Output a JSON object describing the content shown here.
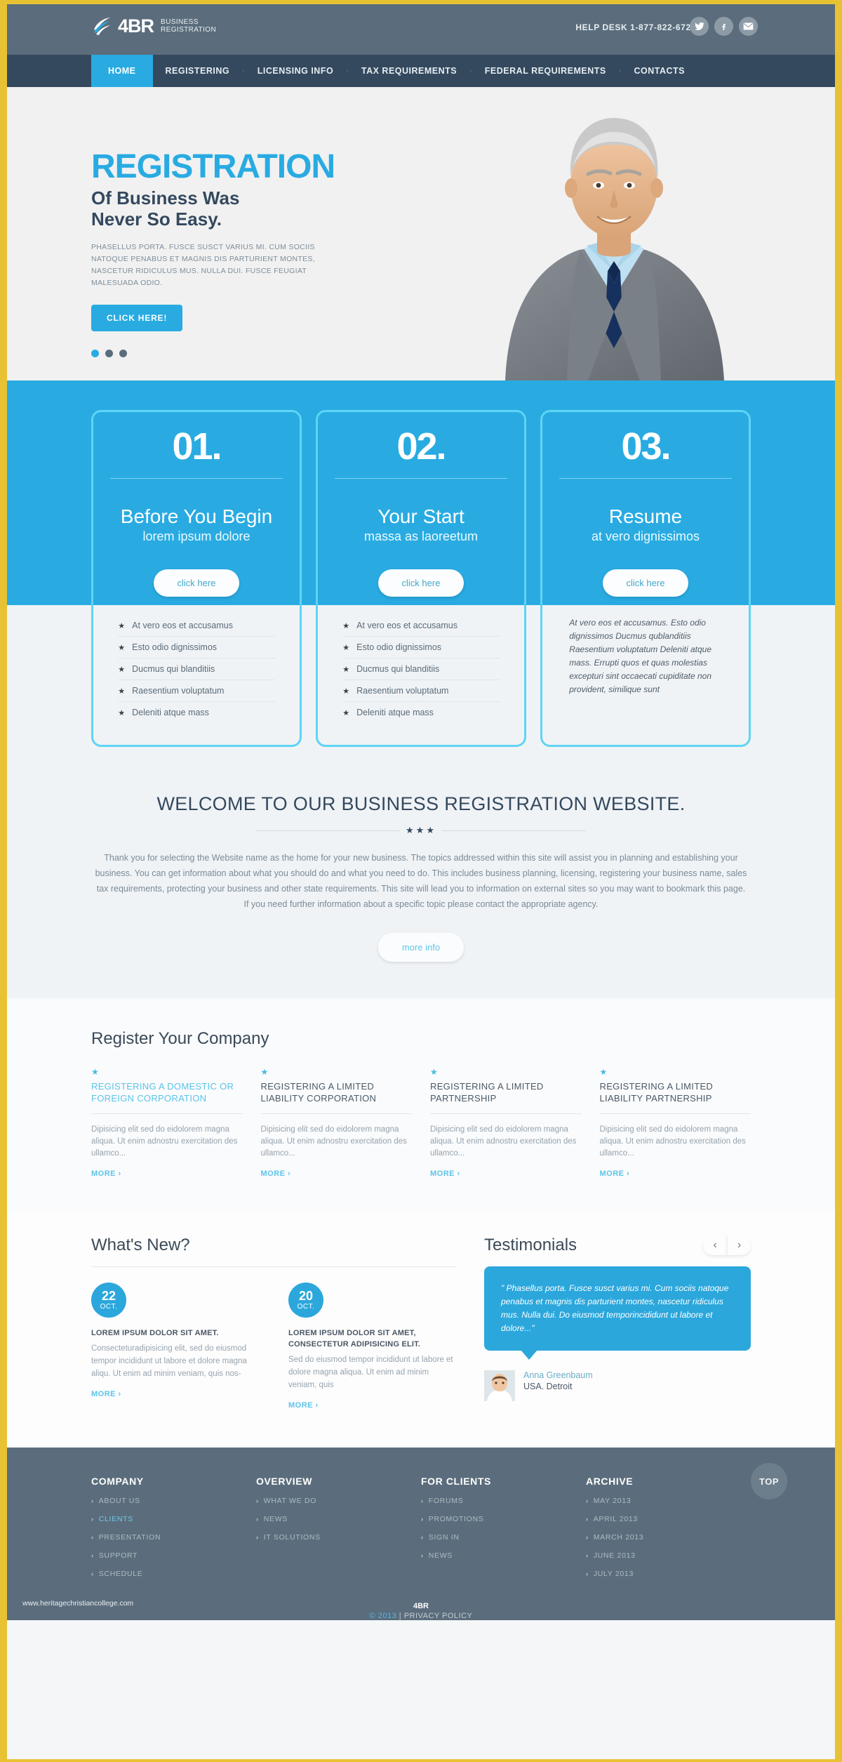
{
  "header": {
    "logo_main": "4BR",
    "logo_sub_line1": "BUSINESS",
    "logo_sub_line2": "REGISTRATION",
    "help_desk": "HELP DESK 1-877-822-6727",
    "social": [
      {
        "name": "twitter-icon",
        "glyph": "🐦"
      },
      {
        "name": "facebook-icon",
        "glyph": "f"
      },
      {
        "name": "email-icon",
        "glyph": "✉"
      }
    ]
  },
  "nav": {
    "items": [
      {
        "label": "HOME",
        "active": true
      },
      {
        "label": "REGISTERING",
        "active": false
      },
      {
        "label": "LICENSING INFO",
        "active": false
      },
      {
        "label": "TAX REQUIREMENTS",
        "active": false
      },
      {
        "label": "FEDERAL REQUIREMENTS",
        "active": false
      },
      {
        "label": "CONTACTS",
        "active": false
      }
    ],
    "separator": "·"
  },
  "hero": {
    "title": "REGISTRATION",
    "subtitle_line1": "Of Business Was",
    "subtitle_line2": "Never So Easy.",
    "paragraph": "PHASELLUS PORTA. FUSCE SUSCT VARIUS MI. CUM SOCIIS NATOQUE PENABUS ET MAGNIS DIS PARTURIENT MONTES, NASCETUR RIDICULUS MUS. NULLA DUI. FUSCE FEUGIAT MALESUADA ODIO.",
    "button": "CLICK HERE!",
    "slide_count": 3,
    "active_slide": 1
  },
  "features": {
    "boxes": [
      {
        "number": "01.",
        "title": "Before You Begin",
        "subtitle": "lorem ipsum dolore",
        "button": "click here",
        "list": [
          "At vero eos et accusamus",
          "Esto odio dignissimos",
          "Ducmus qui blanditiis",
          "Raesentium voluptatum",
          "Deleniti atque mass"
        ],
        "paragraph": ""
      },
      {
        "number": "02.",
        "title": "Your Start",
        "subtitle": "massa as laoreetum",
        "button": "click here",
        "list": [
          "At vero eos et accusamus",
          "Esto odio dignissimos",
          "Ducmus qui blanditiis",
          "Raesentium voluptatum",
          "Deleniti atque mass"
        ],
        "paragraph": ""
      },
      {
        "number": "03.",
        "title": "Resume",
        "subtitle": "at vero dignissimos",
        "button": "click here",
        "list": [],
        "paragraph": "At vero eos et accusamus.  Esto odio dignissimos Ducmus qublanditiis Raesentium voluptatum Deleniti atque mass. Errupti quos et quas molestias excepturi sint occaecati cupiditate non provident, similique sunt"
      }
    ],
    "star_glyph": "★"
  },
  "welcome": {
    "heading": "WELCOME TO OUR BUSINESS REGISTRATION WEBSITE.",
    "stars": "★★★",
    "paragraph": "Thank you for selecting the Website name as the home for your new business. The topics addressed within this site will assist you in planning and establishing your business. You can get information about what you should do and what you need to do. This includes business planning, licensing, registering your business name, sales tax requirements, protecting your business and other state requirements. This site will lead you to information on external sites so you may want to bookmark this page. If you need further information about a specific topic please contact the appropriate agency.",
    "button": "more info"
  },
  "register": {
    "heading": "Register Your Company",
    "more_label": "MORE",
    "more_arrow": "›",
    "star_glyph": "★",
    "cards": [
      {
        "title": "REGISTERING A DOMESTIC OR FOREIGN CORPORATION",
        "highlighted": true,
        "text": "Dipisicing elit sed do eidolorem magna aliqua. Ut enim adnostru exercitation des ullamco..."
      },
      {
        "title": "REGISTERING A LIMITED LIABILITY CORPORATION",
        "highlighted": false,
        "text": "Dipisicing elit sed do eidolorem magna aliqua. Ut enim adnostru exercitation des ullamco..."
      },
      {
        "title": "REGISTERING A LIMITED PARTNERSHIP",
        "highlighted": false,
        "text": "Dipisicing elit sed do eidolorem magna aliqua. Ut enim adnostru exercitation des ullamco..."
      },
      {
        "title": "REGISTERING A LIMITED LIABILITY PARTNERSHIP",
        "highlighted": false,
        "text": "Dipisicing elit sed do eidolorem magna aliqua. Ut enim adnostru exercitation des ullamco..."
      }
    ]
  },
  "news": {
    "heading": "What's New?",
    "more_label": "MORE",
    "more_arrow": "›",
    "items": [
      {
        "day": "22",
        "month": "OCT.",
        "title": "LOREM IPSUM DOLOR SIT AMET.",
        "text": "Consecteturadipisicing elit, sed do eiusmod tempor incididunt ut labore et dolore magna aliqu. Ut enim ad minim veniam, quis nos-"
      },
      {
        "day": "20",
        "month": "OCT.",
        "title": "LOREM IPSUM DOLOR SIT AMET, CONSECTETUR ADIPISICING ELIT.",
        "text": "Sed do eiusmod tempor incididunt ut labore et dolore magna aliqua. Ut enim ad minim veniam, quis"
      }
    ]
  },
  "testimonials": {
    "heading": "Testimonials",
    "prev_arrow": "‹",
    "next_arrow": "›",
    "quote": "\" Phasellus porta. Fusce susct varius mi. Cum sociis natoque penabus et magnis dis parturient montes, nascetur ridiculus mus. Nulla dui. Do eiusmod temporincididunt ut labore et dolore...\"",
    "author_name": "Anna Greenbaum",
    "author_location": "USA. Detroit"
  },
  "footer": {
    "columns": [
      {
        "heading": "COMPANY",
        "links": [
          {
            "label": "ABOUT US",
            "active": false
          },
          {
            "label": "CLIENTS",
            "active": true
          },
          {
            "label": "PRESENTATION",
            "active": false
          },
          {
            "label": "SUPPORT",
            "active": false
          },
          {
            "label": "SCHEDULE",
            "active": false
          }
        ]
      },
      {
        "heading": "OVERVIEW",
        "links": [
          {
            "label": "WHAT WE DO",
            "active": false
          },
          {
            "label": "NEWS",
            "active": false
          },
          {
            "label": "IT SOLUTIONS",
            "active": false
          }
        ]
      },
      {
        "heading": "FOR CLIENTS",
        "links": [
          {
            "label": "FORUMS",
            "active": false
          },
          {
            "label": "PROMOTIONS",
            "active": false
          },
          {
            "label": "SIGN IN",
            "active": false
          },
          {
            "label": "NEWS",
            "active": false
          }
        ]
      },
      {
        "heading": "ARCHIVE",
        "links": [
          {
            "label": "MAY 2013",
            "active": false
          },
          {
            "label": "APRIL 2013",
            "active": false
          },
          {
            "label": "MARCH 2013",
            "active": false
          },
          {
            "label": "JUNE 2013",
            "active": false
          },
          {
            "label": "JULY 2013",
            "active": false
          }
        ]
      }
    ],
    "chevron": "›",
    "top_button": "TOP",
    "copyright_brand": "4BR",
    "copyright_year": "© 2013",
    "copyright_rest": "| PRIVACY POLICY",
    "watermark": "www.heritagechristiancollege.com"
  },
  "colors": {
    "accent": "#29abe2",
    "dark": "#34495e",
    "slate": "#5b6d7c",
    "border_yellow": "#e8c233"
  }
}
